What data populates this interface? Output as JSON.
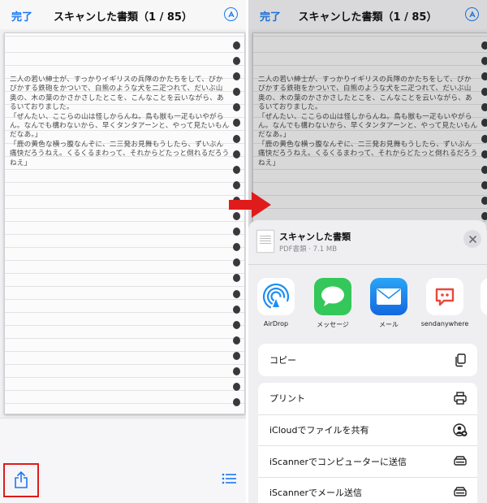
{
  "nav": {
    "done": "完了",
    "title": "スキャンした書類（1 / 85）"
  },
  "handwriting": {
    "lines": [
      "二人の若い紳士が、すっかりイギリスの兵隊のかたちをして、ぴかぴかする鉄砲をかついで、白熊のような犬を二疋つれて、だいぶ山奥の、木の葉のかさかさしたとこを、こんなことを云いながら、あるいておりました。",
      "「ぜんたい、ここらの山は怪しからんね。鳥も獣も一疋もいやがらん。なんでも構わないから、早くタンタアーンと、やって見たいもんだなあ。」",
      "「鹿の黄色な横っ腹なんぞに、二三発お見舞もうしたら、ずいぶん痛快だろうねえ。くるくるまわって、それからどたっと倒れるだろうねえ」"
    ]
  },
  "share_sheet": {
    "doc_name": "スキャンした書類",
    "doc_meta": "PDF書類 · 7.1 MB",
    "apps": [
      {
        "label": "AirDrop"
      },
      {
        "label": "メッセージ"
      },
      {
        "label": "メール"
      },
      {
        "label": "sendanywhere"
      }
    ],
    "actions_group1": [
      {
        "label": "コピー"
      }
    ],
    "actions_group2": [
      {
        "label": "プリント"
      },
      {
        "label": "iCloudでファイルを共有"
      },
      {
        "label": "iScannerでコンピューターに送信"
      },
      {
        "label": "iScannerでメール送信"
      }
    ]
  },
  "colors": {
    "accent": "#1a78f2",
    "highlight": "#e01b1b",
    "messages_green": "#34c759",
    "mail_blue": "#1c8ef2",
    "sendanywhere_red": "#e8493c"
  }
}
